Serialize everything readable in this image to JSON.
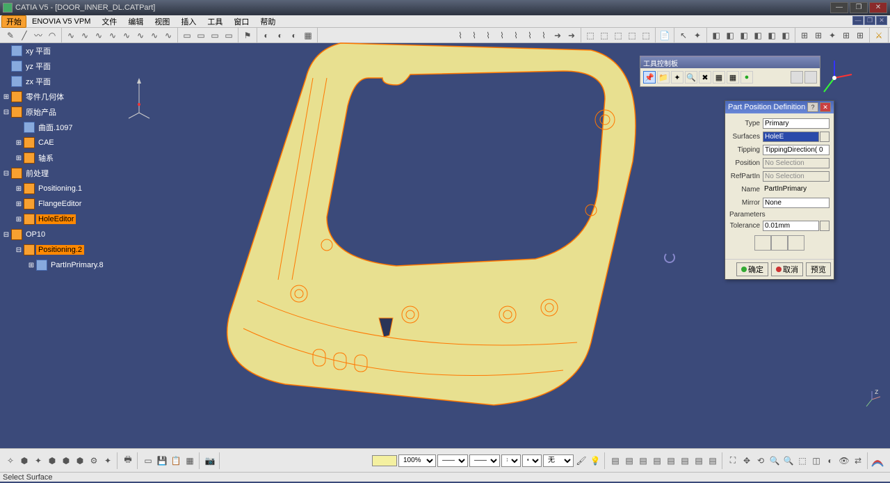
{
  "window": {
    "title": "CATIA V5 - [DOOR_INNER_DL.CATPart]"
  },
  "menu": {
    "items": [
      "开始",
      "ENOVIA V5 VPM",
      "文件",
      "编辑",
      "视图",
      "插入",
      "工具",
      "窗口",
      "帮助"
    ]
  },
  "tree": {
    "items": [
      {
        "indent": 0,
        "icon": "plane",
        "label": "xy 平面",
        "exp": ""
      },
      {
        "indent": 0,
        "icon": "plane",
        "label": "yz 平面",
        "exp": ""
      },
      {
        "indent": 0,
        "icon": "plane",
        "label": "zx 平面",
        "exp": ""
      },
      {
        "indent": 0,
        "icon": "geom",
        "label": "零件几何体",
        "exp": "+"
      },
      {
        "indent": 0,
        "icon": "set",
        "label": "原始产品",
        "exp": "-"
      },
      {
        "indent": 1,
        "icon": "surf",
        "label": "曲面.1097",
        "exp": ""
      },
      {
        "indent": 1,
        "icon": "set",
        "label": "CAE",
        "exp": "+"
      },
      {
        "indent": 1,
        "icon": "set",
        "label": "轴系",
        "exp": "+"
      },
      {
        "indent": 0,
        "icon": "set",
        "label": "前处理",
        "exp": "-"
      },
      {
        "indent": 1,
        "icon": "pos",
        "label": "Positioning.1",
        "exp": "+"
      },
      {
        "indent": 1,
        "icon": "flg",
        "label": "FlangeEditor",
        "exp": "+"
      },
      {
        "indent": 1,
        "icon": "hole",
        "label": "HoleEditor",
        "exp": "+",
        "sel": true
      },
      {
        "indent": 0,
        "icon": "op",
        "label": "OP10",
        "exp": "-"
      },
      {
        "indent": 1,
        "icon": "pos",
        "label": "Positioning.2",
        "exp": "-",
        "sel2": true
      },
      {
        "indent": 2,
        "icon": "part",
        "label": "PartInPrimary.8",
        "exp": "+"
      }
    ]
  },
  "palette": {
    "title": "工具控制板"
  },
  "dialog": {
    "title": "Part Position Definition",
    "type_label": "Type",
    "type_value": "Primary",
    "surfaces_label": "Surfaces",
    "surfaces_value": "HoleE",
    "tipping_label": "Tipping",
    "tipping_value": "TippingDirection(   0",
    "position_label": "Position",
    "position_value": "No Selection",
    "refpartin_label": "RefPartIn",
    "refpartin_value": "No Selection",
    "name_label": "Name",
    "name_value": "PartInPrimary",
    "mirror_label": "Mirror",
    "mirror_value": "None",
    "parameters_label": "Parameters",
    "tolerance_label": "Tolerance",
    "tolerance_value": "0.01mm",
    "ok": "确定",
    "cancel": "取消",
    "preview": "预览"
  },
  "bottom": {
    "zoom": "100%",
    "dash": "———",
    "x": "×",
    "unit": "无"
  },
  "status": {
    "text": "Select Surface"
  }
}
